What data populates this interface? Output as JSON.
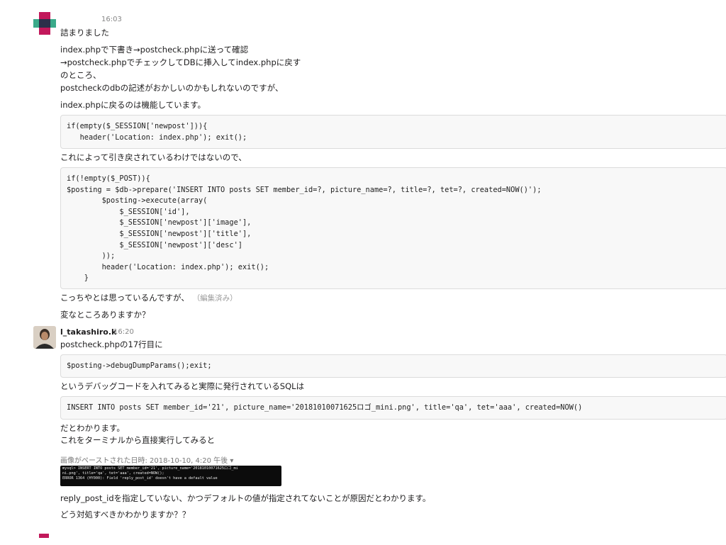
{
  "first_message": {
    "time": "16:03",
    "lines": [
      "詰まりました",
      "index.phpで下書き→postcheck.phpに送って確認",
      "→postcheck.phpでチェックしてDBに挿入してindex.phpに戻す",
      "のところ、",
      "postcheckのdbの記述がおかしいのかもしれないのですが、",
      "index.phpに戻るのは機能しています。"
    ],
    "code1": "if(empty($_SESSION['newpost'])){\n   header('Location: index.php'); exit();",
    "line_after_code1": "これによって引き戻されているわけではないので、",
    "code2": "if(!empty($_POST)){\n$posting = $db->prepare('INSERT INTO posts SET member_id=?, picture_name=?, title=?, tet=?, created=NOW()');\n        $posting->execute(array(\n            $_SESSION['id'],\n            $_SESSION['newpost']['image'],\n            $_SESSION['newpost']['title'],\n            $_SESSION['newpost']['desc']\n        ));\n        header('Location: index.php'); exit();\n    }",
    "line_after_code2": "こっちやとは思っているんですが、",
    "edited_label": "（編集済み）",
    "question": "変なところありますか？"
  },
  "second_message": {
    "sender": "l_takashiro.k",
    "time": "16:20",
    "line1": "postcheck.phpの17行目に",
    "code1": "$posting->debugDumpParams();exit;",
    "line2": "というデバッグコードを入れてみると実際に発行されているSQLは",
    "code2": "INSERT INTO posts SET member_id='21', picture_name='20181010071625ロゴ_mini.png', title='qa', tet='aaa', created=NOW()",
    "line3": "だとわかります。",
    "line4": "これをターミナルから直接実行してみると",
    "image_meta": "画像がペーストされた日時: 2018-10-10, 4:20 午後 ▾",
    "terminal_lines": [
      "mysql> INSERT INTO posts SET member_id='21', picture_name='20181010071625ロゴ_mi",
      "ni.png', title='qa', tet='aaa', created=NOW();",
      "ERROR 1364 (HY000): Field 'reply_post_id' doesn't have a default value"
    ],
    "line5": "reply_post_idを指定していない、かつデフォルトの値が指定されてないことが原因だとわかります。",
    "line6": "どう対処すべきかわかりますか？？"
  }
}
